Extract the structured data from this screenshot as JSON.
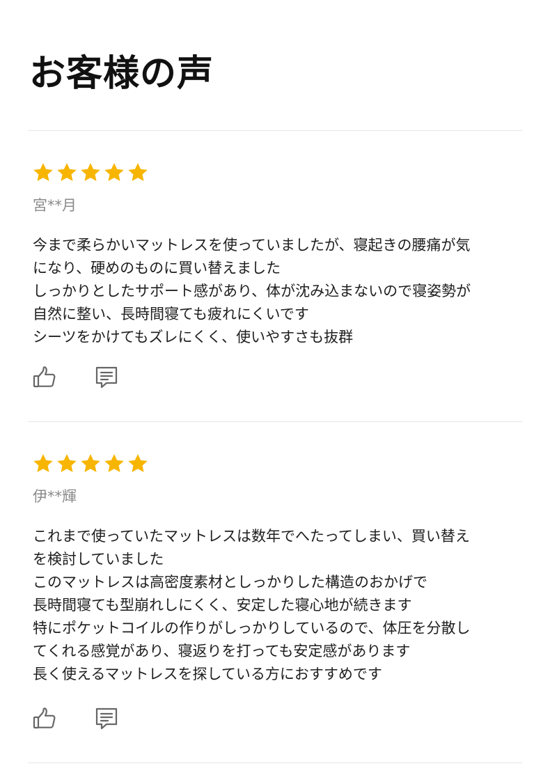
{
  "page": {
    "title": "お客様の声"
  },
  "colors": {
    "star": "#F7B500",
    "icon": "#666666",
    "divider": "#E6E6E6"
  },
  "reviews": [
    {
      "rating": 5,
      "author": "宮**月",
      "lines": [
        "今まで柔らかいマットレスを使っていましたが、寝起きの腰痛が気",
        "になり、硬めのものに買い替えました",
        "しっかりとしたサポート感があり、体が沈み込まないので寝姿勢が",
        "自然に整い、長時間寝ても疲れにくいです",
        "シーツをかけてもズレにくく、使いやすさも抜群"
      ],
      "icons": {
        "like": "thumbs-up-icon",
        "comment": "comment-icon"
      }
    },
    {
      "rating": 5,
      "author": "伊**輝",
      "lines": [
        "これまで使っていたマットレスは数年でへたってしまい、買い替え",
        "を検討していました",
        "このマットレスは高密度素材としっかりした構造のおかげで",
        "長時間寝ても型崩れしにくく、安定した寝心地が続きます",
        "特にポケットコイルの作りがしっかりしているので、体圧を分散し",
        "てくれる感覚があり、寝返りを打っても安定感があります",
        "長く使えるマットレスを探している方におすすめです"
      ],
      "icons": {
        "like": "thumbs-up-icon",
        "comment": "comment-icon"
      }
    }
  ]
}
